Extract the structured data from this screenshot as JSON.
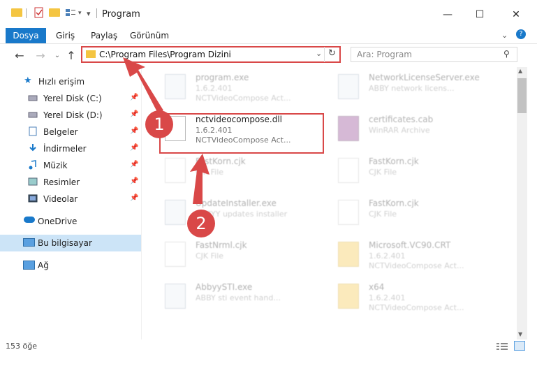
{
  "window": {
    "title": "Program",
    "minimize": "—",
    "maximize": "☐",
    "close": "✕"
  },
  "ribbon": {
    "file": "Dosya",
    "tabs": [
      "Giriş",
      "Paylaş",
      "Görünüm"
    ]
  },
  "address": {
    "path": "C:\\Program Files\\Program Dizini",
    "search_placeholder": "Ara: Program"
  },
  "nav": {
    "quick_access": "Hızlı erişim",
    "items": [
      {
        "label": "Yerel Disk (C:)",
        "icon": "drive-icon"
      },
      {
        "label": "Yerel Disk (D:)",
        "icon": "drive-icon"
      },
      {
        "label": "Belgeler",
        "icon": "documents-icon"
      },
      {
        "label": "İndirmeler",
        "icon": "download-icon"
      },
      {
        "label": "Müzik",
        "icon": "music-icon"
      },
      {
        "label": "Resimler",
        "icon": "pictures-icon"
      },
      {
        "label": "Videolar",
        "icon": "videos-icon"
      }
    ],
    "onedrive": "OneDrive",
    "this_pc": "Bu bilgisayar",
    "network": "Ağ"
  },
  "files": [
    {
      "name": "program.exe",
      "l2": "1.6.2.401",
      "l3": "NCTVideoCompose Act...",
      "type": "exe"
    },
    {
      "name": "NetworkLicenseServer.exe",
      "l2": "ABBY network licens...",
      "l3": "",
      "type": "exe"
    },
    {
      "name": "nctvideocompose.dll",
      "l2": "1.6.2.401",
      "l3": "NCTVideoCompose Act...",
      "type": "dll"
    },
    {
      "name": "certificates.cab",
      "l2": "WinRAR Archive",
      "l3": "",
      "type": "zip"
    },
    {
      "name": "FastKorn.cjk",
      "l2": "CJK File",
      "l3": "",
      "type": "doc"
    },
    {
      "name": "FastKorn.cjk",
      "l2": "CJK File",
      "l3": "",
      "type": "doc"
    },
    {
      "name": "UpdateInstaller.exe",
      "l2": "ABBYY updates installer",
      "l3": "",
      "type": "exe"
    },
    {
      "name": "FastKorn.cjk",
      "l2": "CJK File",
      "l3": "",
      "type": "doc"
    },
    {
      "name": "FastNrml.cjk",
      "l2": "CJK File",
      "l3": "",
      "type": "doc"
    },
    {
      "name": "Microsoft.VC90.CRT",
      "l2": "1.6.2.401",
      "l3": "NCTVideoCompose Act...",
      "type": "folder"
    },
    {
      "name": "AbbyySTI.exe",
      "l2": "ABBY sti event hand...",
      "l3": "",
      "type": "exe"
    },
    {
      "name": "x64",
      "l2": "1.6.2.401",
      "l3": "NCTVideoCompose Act...",
      "type": "folder"
    }
  ],
  "status": {
    "count": "153 öğe"
  },
  "callouts": [
    "1",
    "2"
  ],
  "colors": {
    "accent": "#1979ca",
    "highlight": "#d94848"
  }
}
